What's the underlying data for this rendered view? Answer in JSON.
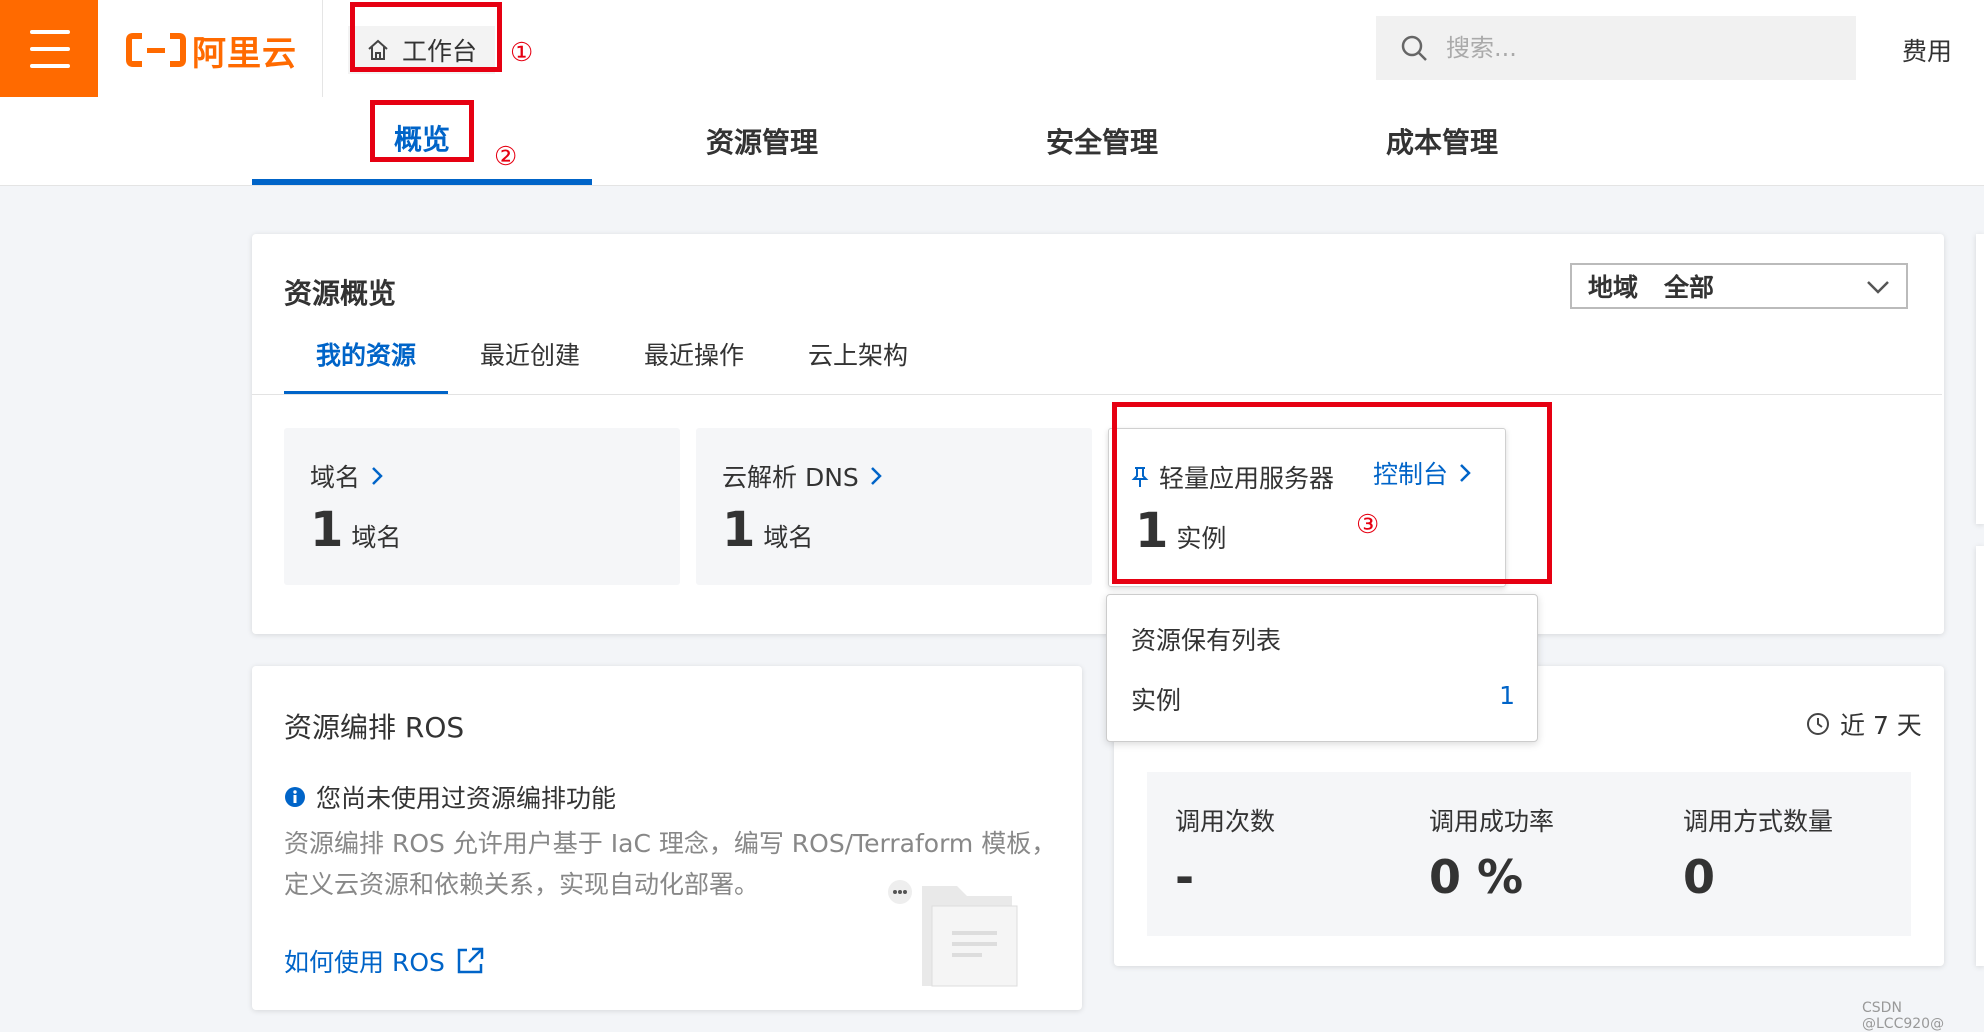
{
  "header": {
    "brand": "阿里云",
    "workbench_label": "工作台",
    "search_placeholder": "搜索...",
    "fee_label": "费用"
  },
  "nav": {
    "tabs": [
      {
        "label": "概览",
        "active": true
      },
      {
        "label": "资源管理",
        "active": false
      },
      {
        "label": "安全管理",
        "active": false
      },
      {
        "label": "成本管理",
        "active": false
      }
    ]
  },
  "overview": {
    "title": "资源概览",
    "region_label": "地域",
    "region_value": "全部",
    "sub_tabs": [
      {
        "label": "我的资源",
        "active": true
      },
      {
        "label": "最近创建",
        "active": false
      },
      {
        "label": "最近操作",
        "active": false
      },
      {
        "label": "云上架构",
        "active": false
      }
    ],
    "resources": [
      {
        "name": "域名",
        "count": "1",
        "unit": "域名"
      },
      {
        "name": "云解析 DNS",
        "count": "1",
        "unit": "域名"
      },
      {
        "name": "轻量应用服务器",
        "count": "1",
        "unit": "实例",
        "console_label": "控制台"
      }
    ]
  },
  "popover": {
    "title": "资源保有列表",
    "row_label": "实例",
    "row_value": "1"
  },
  "ros": {
    "title": "资源编排 ROS",
    "info": "您尚未使用过资源编排功能",
    "description": "资源编排 ROS 允许用户基于 IaC 理念，编写 ROS/Terraform 模板，定义云资源和依赖关系，实现自动化部署。",
    "link_label": "如何使用 ROS"
  },
  "api_stats": {
    "time_range": "近 7 天",
    "stats": [
      {
        "label": "调用次数",
        "value": "-"
      },
      {
        "label": "调用成功率",
        "value": "0 %"
      },
      {
        "label": "调用方式数量",
        "value": "0"
      }
    ]
  },
  "annotations": {
    "marker_1": "①",
    "marker_2": "②",
    "marker_3": "③",
    "color": "#e60012"
  },
  "watermark": "CSDN @LCC920@",
  "colors": {
    "brand_orange": "#ff6a00",
    "link_blue": "#0064c8"
  },
  "icons": {
    "menu": "hamburger-menu-icon",
    "home": "home-icon",
    "search": "search-icon",
    "pin": "pin-icon",
    "clock": "clock-icon",
    "info": "info-icon",
    "external_link": "external-link-icon"
  }
}
